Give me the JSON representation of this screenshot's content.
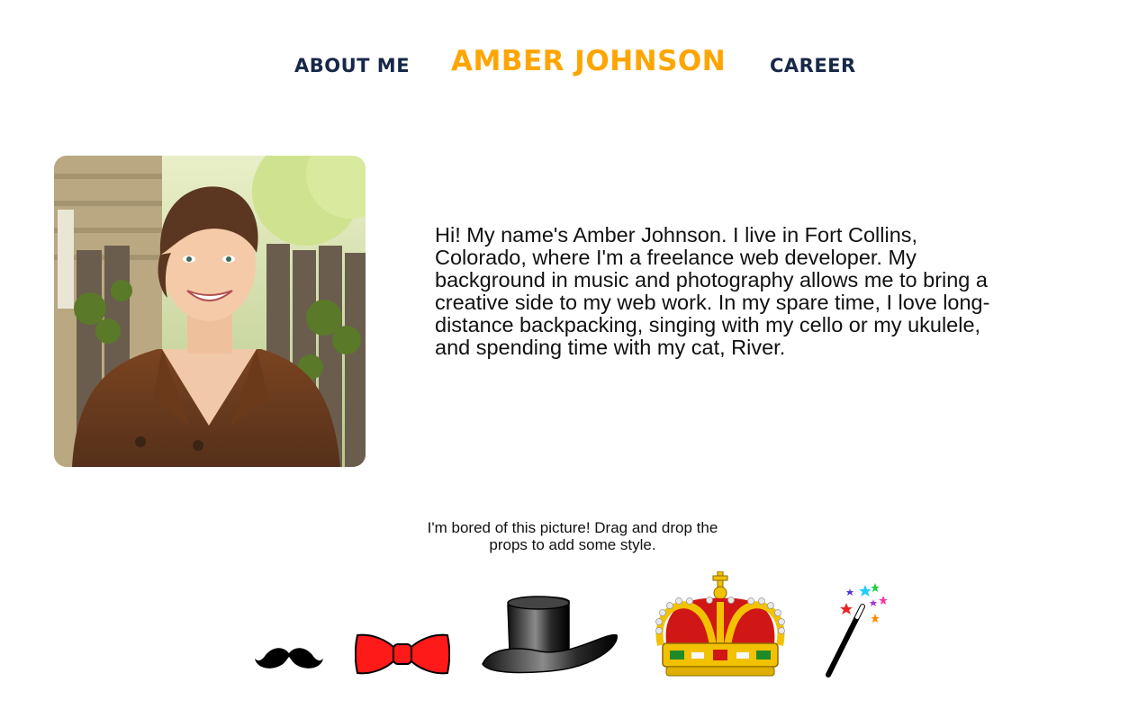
{
  "nav": {
    "about_label": "ABOUT ME",
    "career_label": "CAREER",
    "title": "AMBER JOHNSON"
  },
  "colors": {
    "nav_text": "#172848",
    "title_accent": "#FFA500",
    "body_text": "#111111"
  },
  "profile": {
    "photo_alt": "Portrait photo"
  },
  "bio": {
    "text": "Hi! My name's Amber Johnson. I live in Fort Collins, Colorado, where I'm a freelance web developer. My background in music and photography allows me to bring a creative side to my web work. In my spare time, I love long-distance backpacking, singing with my cello or my ukulele, and spending time with my cat, River."
  },
  "props_prompt": {
    "line1": "I'm bored of this picture! Drag and drop the",
    "line2": "props to add some style."
  },
  "props": [
    {
      "name": "mustache",
      "icon": "mustache-icon"
    },
    {
      "name": "bow tie",
      "icon": "bowtie-icon"
    },
    {
      "name": "top hat",
      "icon": "tophat-icon"
    },
    {
      "name": "crown",
      "icon": "crown-icon"
    },
    {
      "name": "magic wand",
      "icon": "wand-icon"
    }
  ]
}
